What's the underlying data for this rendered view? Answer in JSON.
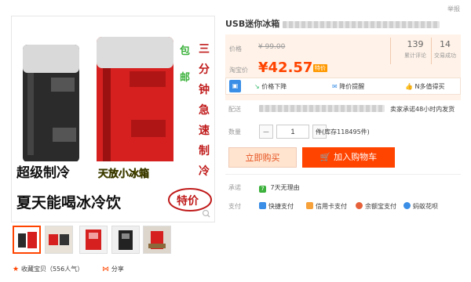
{
  "header": {
    "top_link": "举报"
  },
  "product": {
    "title": "USB迷你冰箱"
  },
  "gallery": {
    "overlay": {
      "line1": "超级制冷",
      "line2": "夏天能喝冰冷饮",
      "side_green": "包邮",
      "side_red": "三分钟急速制冷",
      "yellow": "天放小冰箱",
      "badge": "特价"
    },
    "thumbs": 5,
    "collect_label": "收藏宝贝（556人气）",
    "share_label": "分享"
  },
  "price": {
    "orig_label": "价格",
    "orig_value": "¥ 99.00",
    "now_label": "淘宝价",
    "now_value": "¥42.57",
    "now_tag": "特价",
    "stats": [
      {
        "num": "139",
        "label": "累计评论"
      },
      {
        "num": "14",
        "label": "交易成功"
      }
    ]
  },
  "actions": {
    "drop": "价格下降",
    "remind": "降价提醒",
    "like": "N多值得买"
  },
  "shipping": {
    "label": "配送",
    "note": "卖家承诺48小时内发货"
  },
  "quantity": {
    "label": "数量",
    "value": "1",
    "unit": "件(库存118495件)",
    "minus": "−",
    "plus": "+"
  },
  "buttons": {
    "buy": "立即购买",
    "cart": "加入购物车"
  },
  "promise": {
    "label": "承诺",
    "badge": "7",
    "text": "7天无理由"
  },
  "payment": {
    "label": "支付",
    "methods": [
      "快捷支付",
      "信用卡支付",
      "余额宝支付",
      "蚂蚁花呗"
    ]
  },
  "colors": {
    "accent": "#ff4400",
    "price_bg": "#fff2e8"
  }
}
